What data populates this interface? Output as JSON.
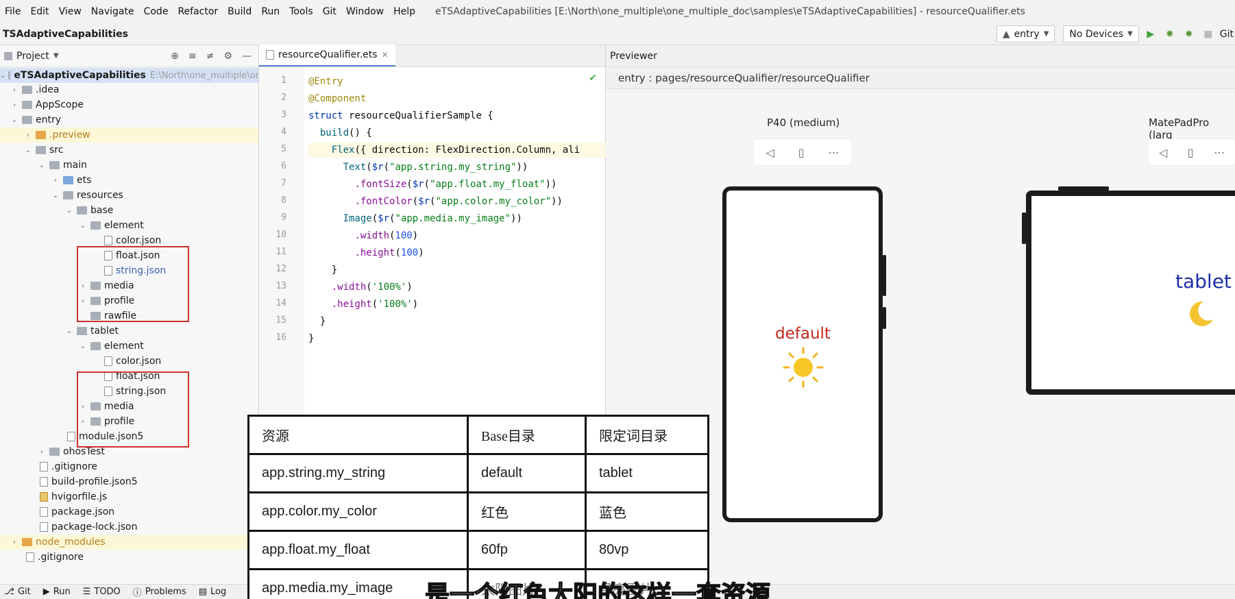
{
  "menu": [
    "File",
    "Edit",
    "View",
    "Navigate",
    "Code",
    "Refactor",
    "Build",
    "Run",
    "Tools",
    "Git",
    "Window",
    "Help"
  ],
  "window_title": "eTSAdaptiveCapabilities [E:\\North\\one_multiple\\one_multiple_doc\\samples\\eTSAdaptiveCapabilities] - resourceQualifier.ets",
  "toolbar": {
    "project": "TSAdaptiveCapabilities",
    "module_combo": "entry",
    "device_combo": "No Devices",
    "git": "Git"
  },
  "project_panel": {
    "title": "Project",
    "root": {
      "name": "eTSAdaptiveCapabilities",
      "path": "E:\\North\\one_multiple\\or"
    },
    "rows": [
      {
        "label": ".idea"
      },
      {
        "label": "AppScope"
      },
      {
        "label": "entry"
      },
      {
        "label": ".preview"
      },
      {
        "label": "src"
      },
      {
        "label": "main"
      },
      {
        "label": "ets"
      },
      {
        "label": "resources"
      },
      {
        "label": "base"
      },
      {
        "label": "element"
      },
      {
        "label": "color.json"
      },
      {
        "label": "float.json"
      },
      {
        "label": "string.json"
      },
      {
        "label": "media"
      },
      {
        "label": "profile"
      },
      {
        "label": "rawfile"
      },
      {
        "label": "tablet"
      },
      {
        "label": "element"
      },
      {
        "label": "color.json"
      },
      {
        "label": "float.json"
      },
      {
        "label": "string.json"
      },
      {
        "label": "media"
      },
      {
        "label": "profile"
      },
      {
        "label": "module.json5"
      },
      {
        "label": "ohosTest"
      },
      {
        "label": ".gitignore"
      },
      {
        "label": "build-profile.json5"
      },
      {
        "label": "hvigorfile.js"
      },
      {
        "label": "package.json"
      },
      {
        "label": "package-lock.json"
      },
      {
        "label": "node_modules"
      },
      {
        "label": ".gitignore"
      }
    ]
  },
  "editor": {
    "tab": "resourceQualifier.ets",
    "line_numbers": [
      "1",
      "2",
      "3",
      "4",
      "5",
      "6",
      "7",
      "8",
      "9",
      "10",
      "11",
      "12",
      "13",
      "14",
      "15",
      "16"
    ]
  },
  "previewer": {
    "title": "Previewer",
    "path": "entry : pages/resourceQualifier/resourceQualifier",
    "device1": "P40 (medium)",
    "device2": "MatePadPro (larg",
    "device1_text": "default",
    "device2_text": "tablet"
  },
  "statusbar": [
    "Git",
    "Run",
    "TODO",
    "Problems",
    "Log"
  ],
  "overlay_table": {
    "headers": [
      "资源",
      "Base目录",
      "限定词目录"
    ],
    "rows": [
      [
        "app.string.my_string",
        "default",
        "tablet"
      ],
      [
        "app.color.my_color",
        "红色",
        "蓝色"
      ],
      [
        "app.float.my_float",
        "60fp",
        "80vp"
      ],
      [
        "app.media.my_image",
        "太阳图片",
        "月亮图片"
      ]
    ]
  },
  "caption": "是一个红色太阳的这样一套资源",
  "colors": {
    "red_box": "#d03030",
    "default_text": "#c0281c",
    "tablet_text": "#1c2fa8",
    "selection": "#d5e1f5"
  }
}
